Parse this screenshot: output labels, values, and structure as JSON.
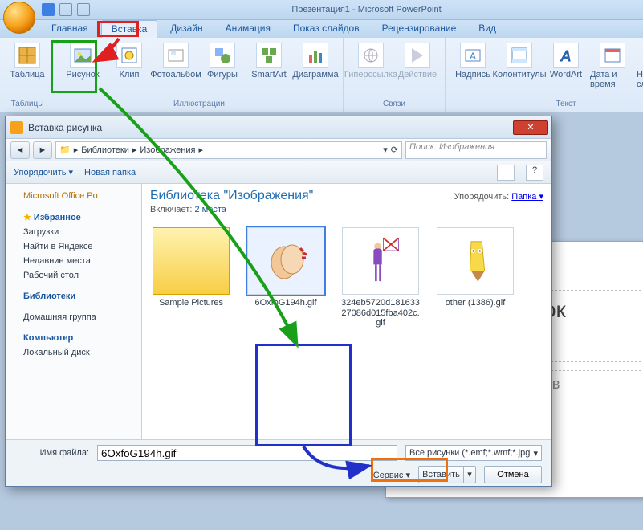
{
  "titlebar": {
    "text": "Презентация1 - Microsoft PowerPoint"
  },
  "tabs": [
    "Главная",
    "Вставка",
    "Дизайн",
    "Анимация",
    "Показ слайдов",
    "Рецензирование",
    "Вид"
  ],
  "active_tab": 1,
  "ribbon": {
    "groups": [
      {
        "label": "Таблицы",
        "items": [
          {
            "name": "table",
            "label": "Таблица"
          }
        ]
      },
      {
        "label": "Иллюстрации",
        "items": [
          {
            "name": "picture",
            "label": "Рисунок"
          },
          {
            "name": "clip",
            "label": "Клип"
          },
          {
            "name": "album",
            "label": "Фотоальбом"
          },
          {
            "name": "shapes",
            "label": "Фигуры"
          },
          {
            "name": "smartart",
            "label": "SmartArt"
          },
          {
            "name": "chart",
            "label": "Диаграмма"
          }
        ]
      },
      {
        "label": "Связи",
        "items": [
          {
            "name": "hyperlink",
            "label": "Гиперссылка",
            "disabled": true
          },
          {
            "name": "action",
            "label": "Действие",
            "disabled": true
          }
        ]
      },
      {
        "label": "Текст",
        "items": [
          {
            "name": "textbox",
            "label": "Надпись"
          },
          {
            "name": "headerfooter",
            "label": "Колонтитулы"
          },
          {
            "name": "wordart",
            "label": "WordArt"
          },
          {
            "name": "datetime",
            "label": "Дата и время"
          },
          {
            "name": "slidenum",
            "label": "Номер слайда"
          }
        ]
      }
    ]
  },
  "slide": {
    "title_placeholder": "оловок",
    "subtitle_placeholder": "дзаголов"
  },
  "dialog": {
    "title": "Вставка рисунка",
    "breadcrumb": [
      "Библиотеки",
      "Изображения"
    ],
    "search_placeholder": "Поиск: Изображения",
    "toolbar": {
      "organize": "Упорядочить ▾",
      "newfolder": "Новая папка"
    },
    "sidebar": {
      "top": "Microsoft Office Po",
      "fav_h": "Избранное",
      "fav": [
        "Загрузки",
        "Найти в Яндексе",
        "Недавние места",
        "Рабочий стол"
      ],
      "lib_h": "Библиотеки",
      "home": "Домашняя группа",
      "comp_h": "Компьютер",
      "comp": [
        "Локальный диск"
      ]
    },
    "library": {
      "heading": "Библиотека \"Изображения\"",
      "includes_label": "Включает:",
      "includes_link": "2 места",
      "sort_label": "Упорядочить:",
      "sort_value": "Папка ▾"
    },
    "files": [
      {
        "name": "Sample Pictures",
        "type": "folder"
      },
      {
        "name": "6OxfoG194h.gif",
        "type": "image",
        "selected": true
      },
      {
        "name": "324eb5720d18163327086d015fba402c.gif",
        "type": "image"
      },
      {
        "name": "other (1386).gif",
        "type": "image"
      }
    ],
    "filename_label": "Имя файла:",
    "filename_value": "6OxfoG194h.gif",
    "filter": "Все рисунки (*.emf;*.wmf;*.jpg",
    "service": "Сервис ▾",
    "insert": "Вставить",
    "cancel": "Отмена"
  }
}
